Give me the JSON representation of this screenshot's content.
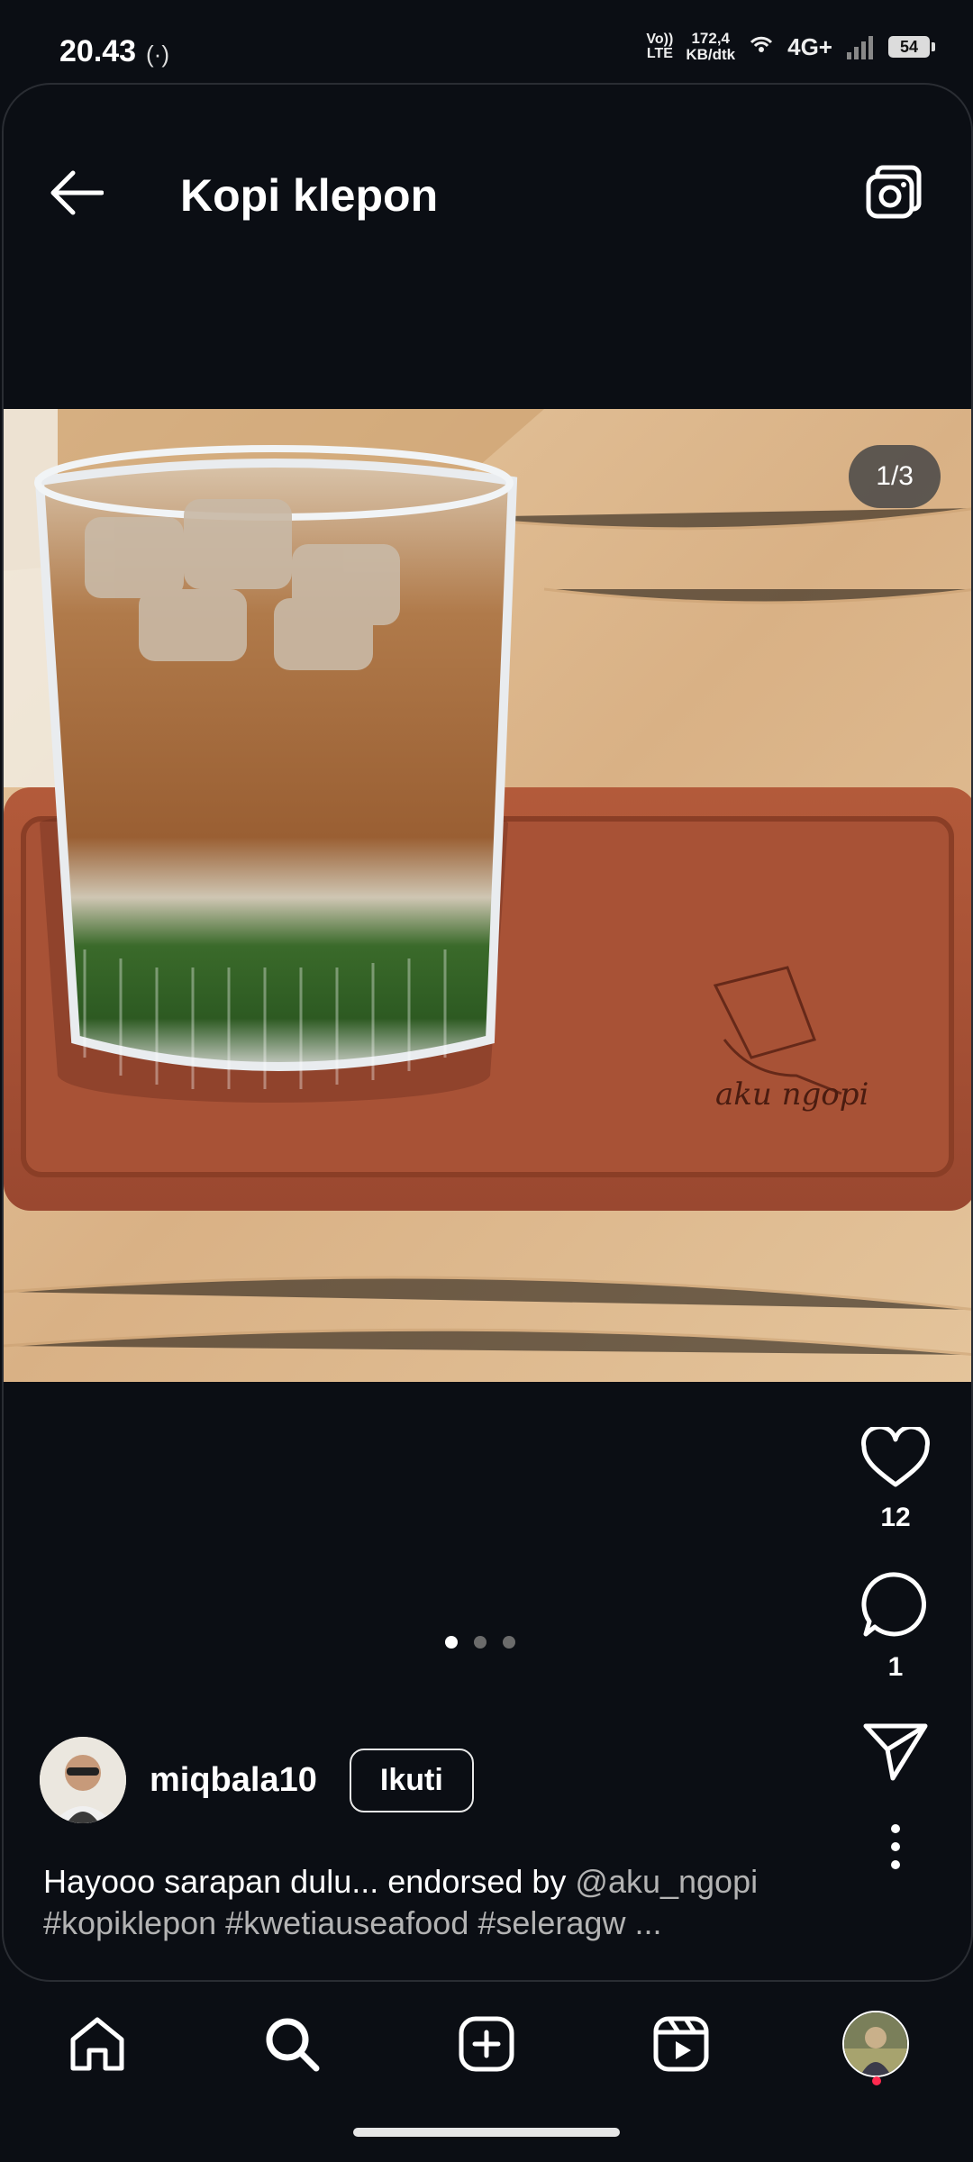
{
  "status_bar": {
    "time": "20.43",
    "hotspot_glyph": "(·)",
    "volte_line1": "Vo))",
    "volte_line2": "LTE",
    "speed_line1": "172,4",
    "speed_line2": "KB/dtk",
    "network": "4G+",
    "battery": "54",
    "icons": [
      "hotspot-icon",
      "wifi-icon",
      "signal-icon",
      "battery-icon"
    ]
  },
  "header": {
    "title": "Kopi klepon",
    "back_icon": "arrow-left-icon",
    "camera_icon": "camera-icon"
  },
  "post": {
    "image_counter": "1/3",
    "image_watermark": "aku ngopi",
    "slide_count": 3,
    "active_slide": 1,
    "likes": "12",
    "comments": "1",
    "username": "miqbala10",
    "follow_label": "Ikuti",
    "caption_text": "Hayooo sarapan dulu... endorsed by ",
    "caption_mention": "@aku_ngopi",
    "caption_tags": "#kopiklepon #kwetiauseafood  #seleragw ..."
  },
  "bottom_nav": {
    "items": [
      "home-icon",
      "search-icon",
      "create-icon",
      "reels-icon",
      "profile-avatar"
    ]
  },
  "colors": {
    "background": "#0b0e14",
    "notification_dot": "#ff2a4f"
  }
}
